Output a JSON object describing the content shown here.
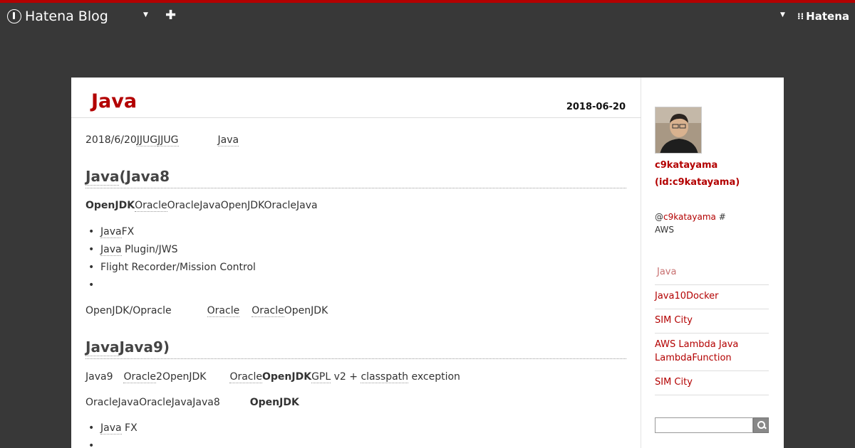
{
  "topbar": {
    "logo_text": "Hatena Blog",
    "right_logo_text": "Hatena",
    "right_logo_mark": "⁝⁝"
  },
  "entry": {
    "title": "Java",
    "date": "2018-06-20",
    "p1": {
      "a": "2018/6/20",
      "b": "JJUG",
      "c": "JJUG",
      "d": "Java"
    },
    "h1": {
      "a": "Java",
      "b": "(Java8"
    },
    "p2": {
      "a": "OpenJDK",
      "b": "Oracle",
      "c": "OracleJavaOpenJDKOracleJava"
    },
    "list1": [
      {
        "a": "Java",
        "b": "FX"
      },
      {
        "a": "Java",
        "b": " Plugin/JWS"
      },
      {
        "a": "",
        "b": "Flight Recorder/Mission Control"
      },
      {
        "a": "",
        "b": ""
      }
    ],
    "p3": {
      "a": "OpenJDK/Opracle",
      "b": "Oracle",
      "c": "Oracle",
      "d": "OpenJDK"
    },
    "h2": {
      "a": "Java",
      "b": "Java9)"
    },
    "p4": {
      "a": "Java9",
      "b": "Oracle",
      "c": "2OpenJDK",
      "d": "Oracle",
      "e": "OpenJDK",
      "f": "GPL",
      "g": " v2 + ",
      "h": "classpath",
      "i": " exception"
    },
    "p5": {
      "a": "OracleJavaOracleJavaJava8",
      "b": "OpenJDK"
    },
    "list2": [
      {
        "a": "Java",
        "b": " FX"
      },
      {
        "a": "",
        "b": ""
      }
    ]
  },
  "sidebar": {
    "name": "c9katayama",
    "id": "(id:c9katayama)",
    "desc_at": "@",
    "desc_handle": "c9katayama",
    "desc_hash": " #",
    "desc_line2": "AWS",
    "items": [
      {
        "label": "Java"
      },
      {
        "label": "Java10Docker"
      },
      {
        "label": "SIM City"
      },
      {
        "label": "AWS Lambda Java LambdaFunction"
      },
      {
        "label": "SIM City"
      }
    ],
    "search_value": ""
  },
  "colors": {
    "accent": "#b30000",
    "header_bg": "#383838"
  }
}
